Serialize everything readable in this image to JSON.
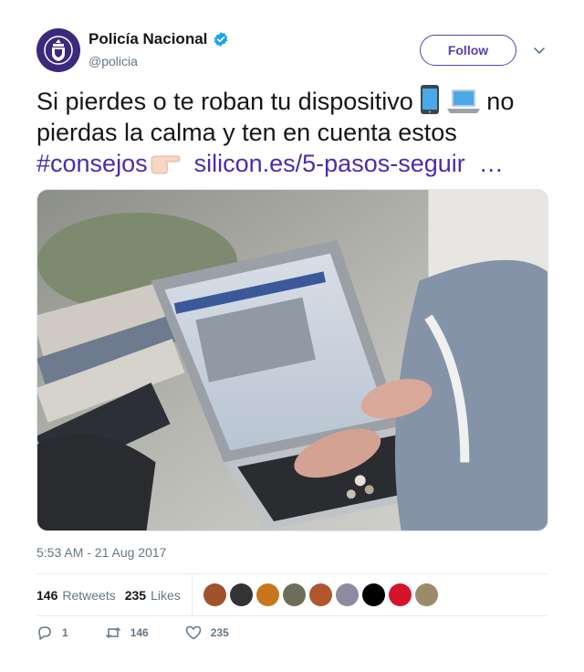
{
  "account": {
    "display_name": "Policía Nacional",
    "handle": "@policia",
    "verified": true,
    "avatar_icon": "police-badge-icon",
    "avatar_color": "#3b2a7c"
  },
  "follow": {
    "label": "Follow",
    "color": "#5a3fb5"
  },
  "menu_icon": "chevron-down-icon",
  "tweet": {
    "text_part1": "Si pierdes o te roban tu dispositivo",
    "emoji_1": "mobile-phone-emoji",
    "emoji_2": "laptop-emoji",
    "text_part2": "no pierdas la calma y ten en cuenta estos",
    "hashtag": "#consejos",
    "emoji_3": "pointing-right-hand-emoji",
    "link": "silicon.es/5-pasos-seguir",
    "ellipsis": "…",
    "link_color": "#4a2db0"
  },
  "media": {
    "description_icon": "laptop-photo"
  },
  "timestamp": "5:53 AM - 21 Aug 2017",
  "stats": {
    "retweets_count": "146",
    "retweets_label": "Retweets",
    "likes_count": "235",
    "likes_label": "Likes"
  },
  "likers": [
    {
      "color": "#a0522d"
    },
    {
      "color": "#333333"
    },
    {
      "color": "#c8761e"
    },
    {
      "color": "#6d6d5a"
    },
    {
      "color": "#b0562c"
    },
    {
      "color": "#8f8aa0"
    },
    {
      "color": "#000000"
    },
    {
      "color": "#d4142b"
    },
    {
      "color": "#9a8b6a"
    }
  ],
  "actions": {
    "reply_count": "1",
    "retweet_count": "146",
    "like_count": "235"
  }
}
